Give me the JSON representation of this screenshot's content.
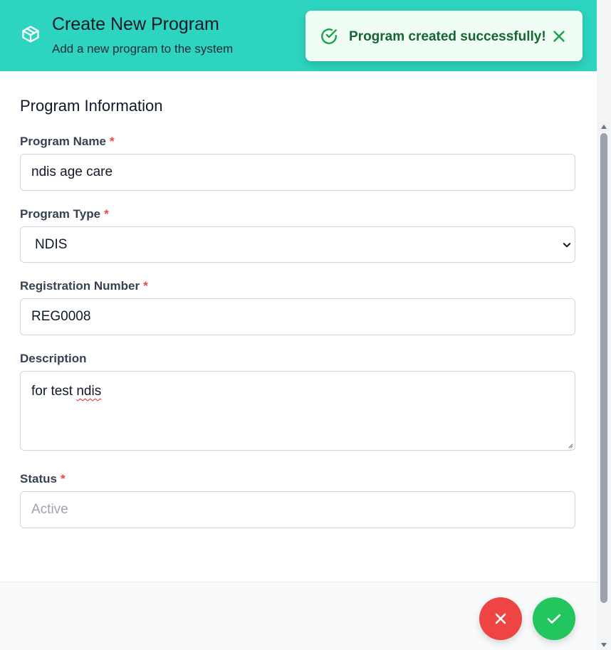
{
  "header": {
    "title": "Create New Program",
    "subtitle": "Add a new program to the system",
    "icon": "package-icon",
    "background": "#2dd4bf"
  },
  "toast": {
    "message": "Program created successfully!",
    "icon": "check-circle-icon",
    "close_icon": "close-icon",
    "background": "#f0fdf4",
    "text_color": "#166534"
  },
  "form": {
    "section_title": "Program Information",
    "required_marker": "*",
    "program_name": {
      "label": "Program Name",
      "value": "ndis age care"
    },
    "program_type": {
      "label": "Program Type",
      "value": "NDIS"
    },
    "registration_number": {
      "label": "Registration Number",
      "value": "REG0008"
    },
    "description": {
      "label": "Description",
      "value_prefix": "for test ",
      "value_misspelled": "ndis"
    },
    "status": {
      "label": "Status",
      "placeholder": "Active"
    }
  },
  "footer": {
    "cancel_icon": "x-icon",
    "confirm_icon": "check-icon",
    "cancel_color": "#ef4444",
    "confirm_color": "#22c55e"
  }
}
